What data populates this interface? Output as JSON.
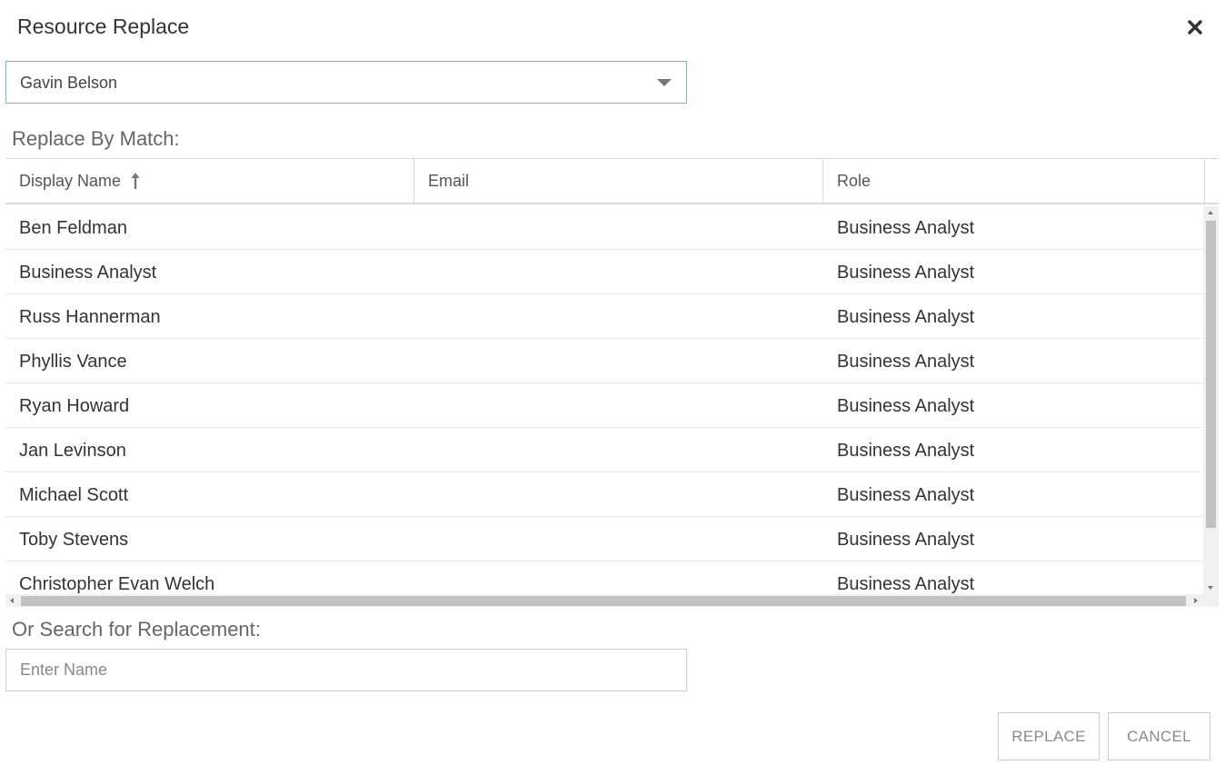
{
  "dialog": {
    "title": "Resource Replace",
    "close_icon": "close-icon"
  },
  "resource_select": {
    "selected": "Gavin Belson",
    "icon": "chevron-down-icon"
  },
  "match_section": {
    "label": "Replace By Match:"
  },
  "grid": {
    "columns": [
      "Display Name",
      "Email",
      "Role"
    ],
    "sort_icon": "sort-ascending-icon",
    "rows": [
      {
        "name": "Ben Feldman",
        "email": "",
        "role": "Business Analyst"
      },
      {
        "name": "Business Analyst",
        "email": "",
        "role": "Business Analyst"
      },
      {
        "name": "Russ Hannerman",
        "email": "",
        "role": "Business Analyst"
      },
      {
        "name": "Phyllis Vance",
        "email": "",
        "role": "Business Analyst"
      },
      {
        "name": "Ryan Howard",
        "email": "",
        "role": "Business Analyst"
      },
      {
        "name": "Jan Levinson",
        "email": "",
        "role": "Business Analyst"
      },
      {
        "name": "Michael Scott",
        "email": "",
        "role": "Business Analyst"
      },
      {
        "name": "Toby Stevens",
        "email": "",
        "role": "Business Analyst"
      },
      {
        "name": "Christopher Evan Welch",
        "email": "",
        "role": "Business Analyst"
      }
    ]
  },
  "search_section": {
    "label": "Or Search for Replacement:",
    "placeholder": "Enter Name",
    "value": ""
  },
  "buttons": {
    "replace": "REPLACE",
    "cancel": "CANCEL"
  }
}
